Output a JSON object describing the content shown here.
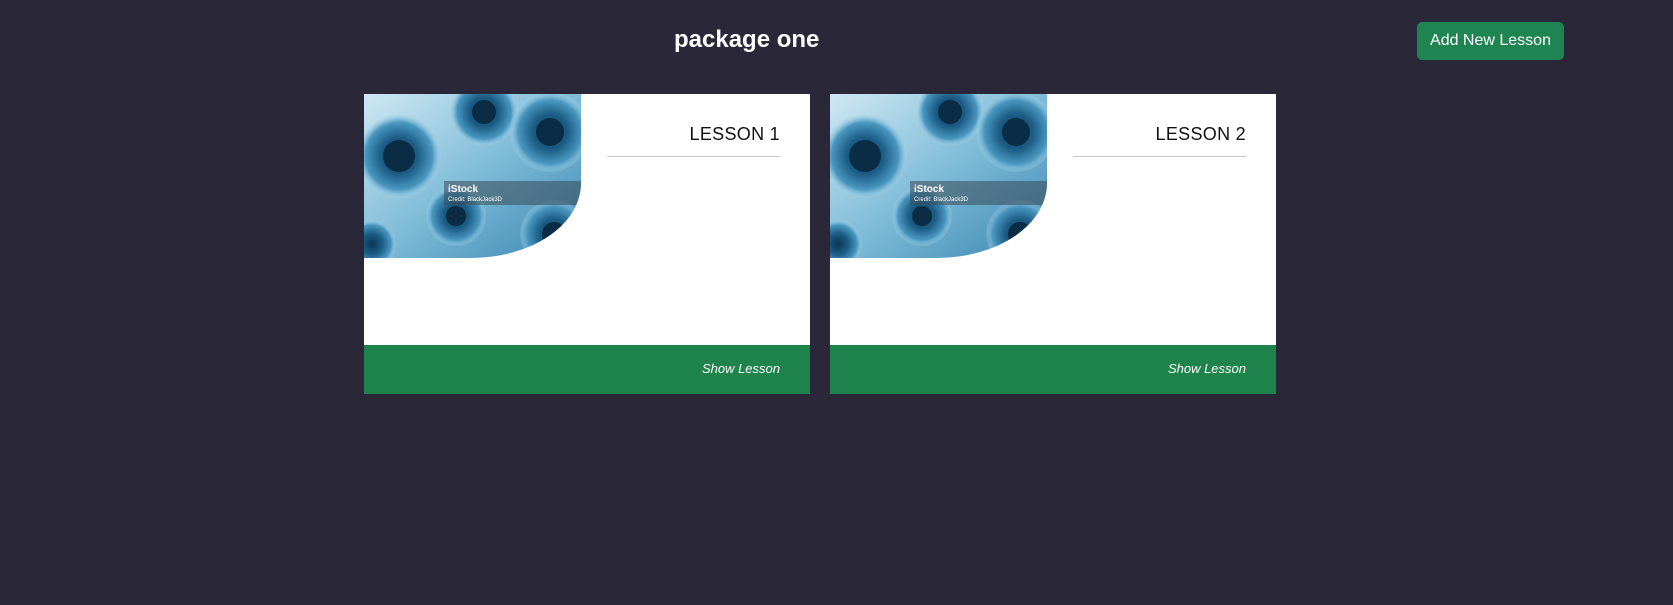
{
  "page": {
    "title": "package one"
  },
  "toolbar": {
    "add_label": "Add New Lesson"
  },
  "lessons": [
    {
      "title": "LESSON 1",
      "action_label": "Show Lesson",
      "image_watermark": "iStock",
      "image_credit": "Credit: BlackJack3D"
    },
    {
      "title": "LESSON 2",
      "action_label": "Show Lesson",
      "image_watermark": "iStock",
      "image_credit": "Credit: BlackJack3D"
    }
  ],
  "colors": {
    "background": "#2a2739",
    "accent_green": "#1e8552",
    "card_bg": "#ffffff",
    "image_blue": "#2a6f9a"
  }
}
